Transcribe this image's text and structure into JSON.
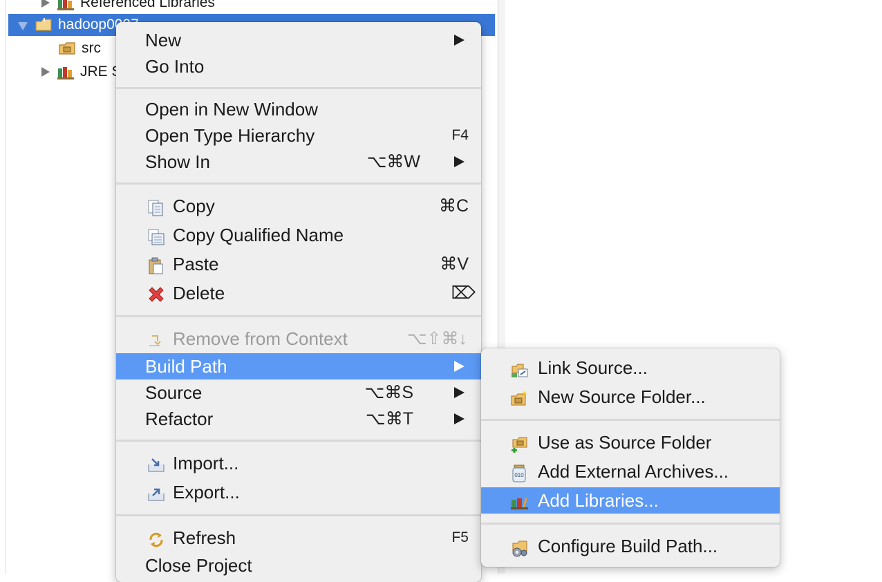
{
  "tree": {
    "referenced_libraries": "Referenced Libraries",
    "project": "hadoop0007",
    "src": "src",
    "jre": "JRE S"
  },
  "menu": {
    "new": "New",
    "go_into": "Go Into",
    "open_new_window": "Open in New Window",
    "open_type_hierarchy": "Open Type Hierarchy",
    "open_type_hierarchy_sc": "F4",
    "show_in": "Show In",
    "show_in_sc": "⌥⌘W",
    "copy": "Copy",
    "copy_sc": "⌘C",
    "copy_qualified": "Copy Qualified Name",
    "paste": "Paste",
    "paste_sc": "⌘V",
    "delete": "Delete",
    "delete_sc": "⌦",
    "remove_context": "Remove from Context",
    "remove_context_sc": "⌥⇧⌘↓",
    "build_path": "Build Path",
    "source": "Source",
    "source_sc": "⌥⌘S",
    "refactor": "Refactor",
    "refactor_sc": "⌥⌘T",
    "import": "Import...",
    "export": "Export...",
    "refresh": "Refresh",
    "refresh_sc": "F5",
    "close_project": "Close Project"
  },
  "submenu": {
    "link_source": "Link Source...",
    "new_source_folder": "New Source Folder...",
    "use_as_source": "Use as Source Folder",
    "add_external": "Add External Archives...",
    "add_libraries": "Add Libraries...",
    "configure": "Configure Build Path..."
  },
  "colors": {
    "highlight": "#5b99f5",
    "selection": "#3a78d6",
    "menu_bg": "#efefef"
  }
}
